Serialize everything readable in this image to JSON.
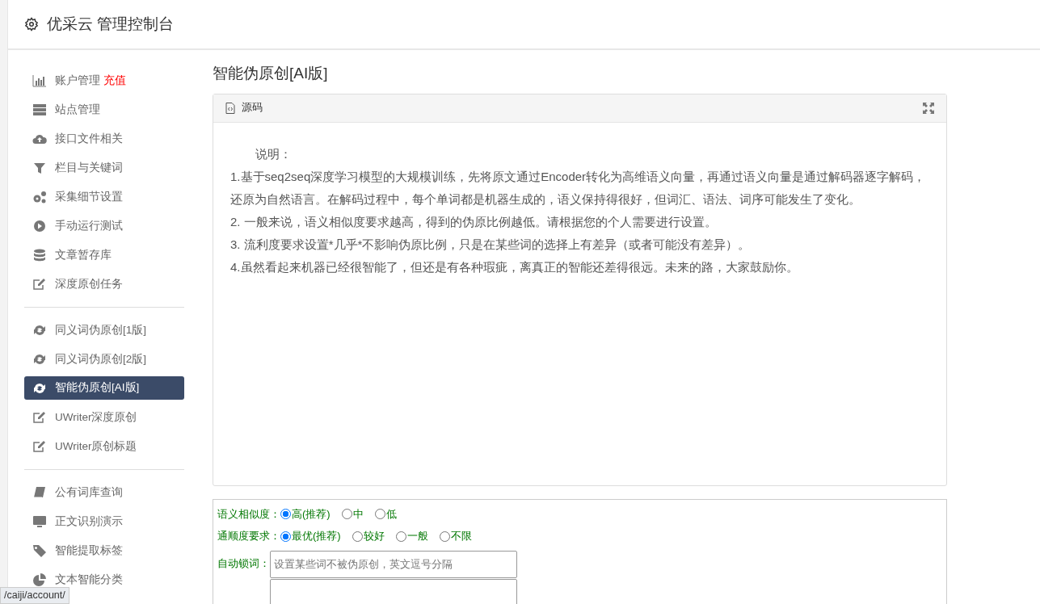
{
  "header": {
    "title": "优采云 管理控制台"
  },
  "sidebar": {
    "groups": [
      {
        "items": [
          {
            "kind": "chart",
            "label": "账户管理",
            "badge": "充值",
            "selected": false
          },
          {
            "kind": "server",
            "label": "站点管理",
            "selected": false
          },
          {
            "kind": "cloud",
            "label": "接口文件相关",
            "selected": false
          },
          {
            "kind": "filter",
            "label": "栏目与关键词",
            "selected": false
          },
          {
            "kind": "gears",
            "label": "采集细节设置",
            "selected": false
          },
          {
            "kind": "play",
            "label": "手动运行测试",
            "selected": false
          },
          {
            "kind": "database",
            "label": "文章暂存库",
            "selected": false
          },
          {
            "kind": "edit",
            "label": "深度原创任务",
            "selected": false
          }
        ]
      },
      {
        "items": [
          {
            "kind": "refresh",
            "label": "同义词伪原创[1版]",
            "selected": false
          },
          {
            "kind": "refresh",
            "label": "同义词伪原创[2版]",
            "selected": false
          },
          {
            "kind": "refresh",
            "label": "智能伪原创[AI版]",
            "selected": true
          },
          {
            "kind": "edit",
            "label": "UWriter深度原创",
            "selected": false
          },
          {
            "kind": "edit",
            "label": "UWriter原创标题",
            "selected": false
          }
        ]
      },
      {
        "items": [
          {
            "kind": "book",
            "label": "公有词库查询",
            "selected": false
          },
          {
            "kind": "monitor",
            "label": "正文识别演示",
            "selected": false
          },
          {
            "kind": "tag",
            "label": "智能提取标签",
            "selected": false
          },
          {
            "kind": "pie",
            "label": "文本智能分类",
            "selected": false
          }
        ]
      }
    ]
  },
  "main": {
    "title": "智能伪原创[AI版]",
    "editor": {
      "tab": "源码",
      "paragraphs": [
        "说明：",
        "1.基于seq2seq深度学习模型的大规模训练，先将原文通过Encoder转化为高维语义向量，再通过语义向量是通过解码器逐字解码，还原为自然语言。在解码过程中，每个单词都是机器生成的，语义保持得很好，但词汇、语法、词序可能发生了变化。",
        "2. 一般来说，语义相似度要求越高，得到的伪原比例越低。请根据您的个人需要进行设置。",
        "3. 流利度要求设置*几乎*不影响伪原比例，只是在某些词的选择上有差异（或者可能没有差异）。",
        "4.虽然看起来机器已经很智能了，但还是有各种瑕疵，离真正的智能还差得很远。未来的路，大家鼓励你。"
      ]
    },
    "options": [
      {
        "label": "语义相似度：",
        "choices": [
          {
            "label": "高(推荐)",
            "selected": true
          },
          {
            "label": "中",
            "selected": false
          },
          {
            "label": "低",
            "selected": false
          }
        ]
      },
      {
        "label": "通顺度要求：",
        "choices": [
          {
            "label": "最优(推荐)",
            "selected": true
          },
          {
            "label": "较好",
            "selected": false
          },
          {
            "label": "一般",
            "selected": false
          },
          {
            "label": "不限",
            "selected": false
          }
        ]
      }
    ],
    "lock_words": {
      "label": "自动锁词：",
      "placeholder": "设置某些词不被伪原创，英文逗号分隔"
    }
  },
  "status_url": "/caiji/account/"
}
